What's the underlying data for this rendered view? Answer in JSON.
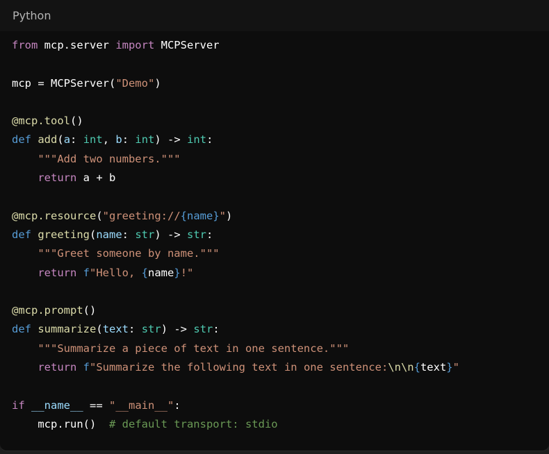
{
  "code_block": {
    "language": "Python",
    "colors": {
      "background": "#0d0d0d",
      "header_background": "#131313",
      "keyword": "#c586c0",
      "def_keyword": "#569cd6",
      "function": "#dcdcaa",
      "string": "#ce9178",
      "type": "#4ec9b0",
      "parameter": "#9cdcfe",
      "comment": "#6a9955",
      "plain": "#ffffff"
    },
    "lines": [
      [
        [
          "kw",
          "from"
        ],
        [
          "plain",
          " mcp.server "
        ],
        [
          "kw",
          "import"
        ],
        [
          "plain",
          " MCPServer"
        ]
      ],
      [],
      [
        [
          "plain",
          "mcp = MCPServer("
        ],
        [
          "str",
          "\"Demo\""
        ],
        [
          "plain",
          ")"
        ]
      ],
      [],
      [
        [
          "dec",
          "@mcp.tool"
        ],
        [
          "plain",
          "()"
        ]
      ],
      [
        [
          "def",
          "def"
        ],
        [
          "plain",
          " "
        ],
        [
          "fn",
          "add"
        ],
        [
          "plain",
          "("
        ],
        [
          "param",
          "a"
        ],
        [
          "plain",
          ": "
        ],
        [
          "type",
          "int"
        ],
        [
          "plain",
          ", "
        ],
        [
          "param",
          "b"
        ],
        [
          "plain",
          ": "
        ],
        [
          "type",
          "int"
        ],
        [
          "plain",
          ") -> "
        ],
        [
          "type",
          "int"
        ],
        [
          "plain",
          ":"
        ]
      ],
      [
        [
          "plain",
          "    "
        ],
        [
          "str",
          "\"\"\"Add two numbers.\"\"\""
        ]
      ],
      [
        [
          "plain",
          "    "
        ],
        [
          "kw",
          "return"
        ],
        [
          "plain",
          " a + b"
        ]
      ],
      [],
      [
        [
          "dec",
          "@mcp.resource"
        ],
        [
          "plain",
          "("
        ],
        [
          "str",
          "\"greeting://"
        ],
        [
          "def",
          "{name}"
        ],
        [
          "str",
          "\""
        ],
        [
          "plain",
          ")"
        ]
      ],
      [
        [
          "def",
          "def"
        ],
        [
          "plain",
          " "
        ],
        [
          "fn",
          "greeting"
        ],
        [
          "plain",
          "("
        ],
        [
          "param",
          "name"
        ],
        [
          "plain",
          ": "
        ],
        [
          "type",
          "str"
        ],
        [
          "plain",
          ") -> "
        ],
        [
          "type",
          "str"
        ],
        [
          "plain",
          ":"
        ]
      ],
      [
        [
          "plain",
          "    "
        ],
        [
          "str",
          "\"\"\"Greet someone by name.\"\"\""
        ]
      ],
      [
        [
          "plain",
          "    "
        ],
        [
          "kw",
          "return"
        ],
        [
          "plain",
          " "
        ],
        [
          "def",
          "f"
        ],
        [
          "str",
          "\"Hello, "
        ],
        [
          "def",
          "{"
        ],
        [
          "plain",
          "name"
        ],
        [
          "def",
          "}"
        ],
        [
          "str",
          "!\""
        ]
      ],
      [],
      [
        [
          "dec",
          "@mcp.prompt"
        ],
        [
          "plain",
          "()"
        ]
      ],
      [
        [
          "def",
          "def"
        ],
        [
          "plain",
          " "
        ],
        [
          "fn",
          "summarize"
        ],
        [
          "plain",
          "("
        ],
        [
          "param",
          "text"
        ],
        [
          "plain",
          ": "
        ],
        [
          "type",
          "str"
        ],
        [
          "plain",
          ") -> "
        ],
        [
          "type",
          "str"
        ],
        [
          "plain",
          ":"
        ]
      ],
      [
        [
          "plain",
          "    "
        ],
        [
          "str",
          "\"\"\"Summarize a piece of text in one sentence.\"\"\""
        ]
      ],
      [
        [
          "plain",
          "    "
        ],
        [
          "kw",
          "return"
        ],
        [
          "plain",
          " "
        ],
        [
          "def",
          "f"
        ],
        [
          "str",
          "\"Summarize the following text in one sentence:"
        ],
        [
          "fn",
          "\\n\\n"
        ],
        [
          "def",
          "{"
        ],
        [
          "plain",
          "text"
        ],
        [
          "def",
          "}"
        ],
        [
          "str",
          "\""
        ]
      ],
      [],
      [
        [
          "kw",
          "if"
        ],
        [
          "plain",
          " "
        ],
        [
          "param",
          "__name__"
        ],
        [
          "plain",
          " == "
        ],
        [
          "str",
          "\"__main__\""
        ],
        [
          "plain",
          ":"
        ]
      ],
      [
        [
          "plain",
          "    mcp.run()  "
        ],
        [
          "cm",
          "# default transport: stdio"
        ]
      ]
    ]
  }
}
